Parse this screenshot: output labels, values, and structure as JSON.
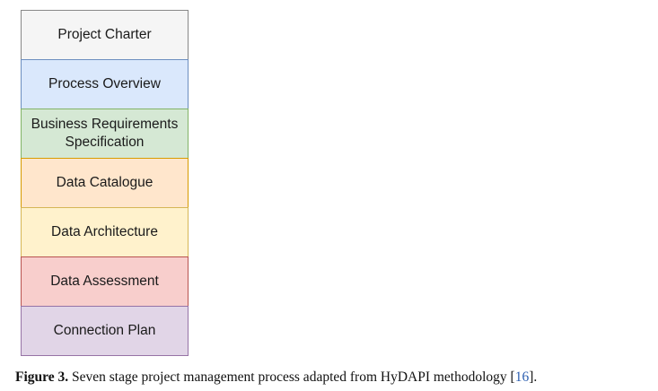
{
  "diagram": {
    "stages": [
      {
        "label": "Project Charter",
        "fill": "#f5f5f5",
        "stroke": "#888888"
      },
      {
        "label": "Process Overview",
        "fill": "#dae8fc",
        "stroke": "#6c8ebf"
      },
      {
        "label": "Business Requirements\nSpecification",
        "fill": "#d5e8d4",
        "stroke": "#82b366"
      },
      {
        "label": "Data Catalogue",
        "fill": "#ffe6cc",
        "stroke": "#d79b00"
      },
      {
        "label": "Data Architecture",
        "fill": "#fff2cc",
        "stroke": "#d6b656"
      },
      {
        "label": "Data Assessment",
        "fill": "#f8cecc",
        "stroke": "#b85450"
      },
      {
        "label": "Connection Plan",
        "fill": "#e1d5e7",
        "stroke": "#9673a6"
      }
    ]
  },
  "caption": {
    "label": "Figure 3.",
    "text": " Seven stage project management process adapted from HyDAPI methodology ",
    "ref_open": "[",
    "ref": "16",
    "ref_close": "]."
  }
}
